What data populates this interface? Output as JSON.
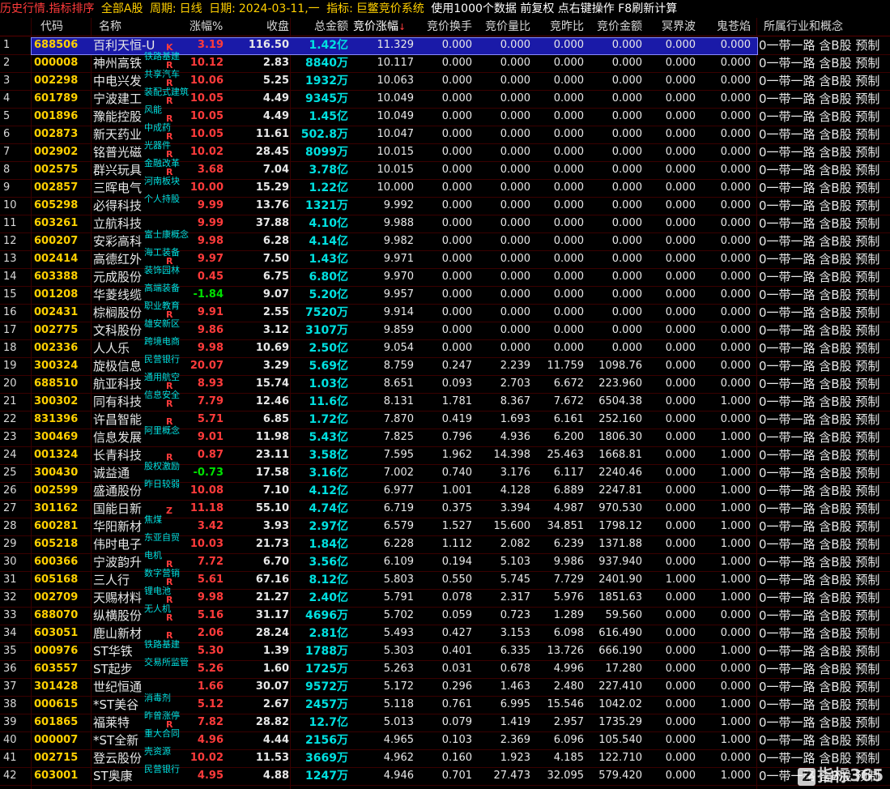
{
  "title_bar": {
    "view": "历史行情.指标排序",
    "scope": "全部A股",
    "period_label": "周期:",
    "period_value": "日线",
    "date_label": "日期:",
    "date_value": "2024-03-11,一",
    "indicator_label": "指标:",
    "indicator_value": "巨鳖竞价系统",
    "note": "使用1000个数据 前复权 点右键操作 F8刷新计算"
  },
  "headers": {
    "code": "代码",
    "name": "名称",
    "chg": "涨幅%",
    "close": "收盘",
    "amount": "总金额",
    "bid_chg": "竞价涨幅",
    "bid_turn": "竞价换手",
    "bid_vol": "竞价量比",
    "bid_yday": "竞昨比",
    "bid_amt": "竞价金额",
    "mj": "冥界波",
    "gc": "鬼苍焰",
    "industry": "所属行业和概念"
  },
  "sort_arrow": "↓",
  "rows": [
    {
      "idx": "1",
      "code": "688506",
      "name": "百利天恒-U",
      "tag": "",
      "flag": "K",
      "chg": "3.19",
      "close": "116.50",
      "amt": "1.42亿",
      "bp": "11.329",
      "bt": "0.000",
      "bv": "0.000",
      "by": "0.000",
      "ba": "0.000",
      "mj": "0.000",
      "gc": "0.000",
      "ind": "0一带一路 含B股 预制"
    },
    {
      "idx": "2",
      "code": "000008",
      "name": "神州高铁",
      "tag": "铁路基建",
      "flag": "R",
      "chg": "10.12",
      "close": "2.83",
      "amt": "8840万",
      "bp": "10.117",
      "bt": "0.000",
      "bv": "0.000",
      "by": "0.000",
      "ba": "0.000",
      "mj": "0.000",
      "gc": "0.000",
      "ind": "0一带一路 含B股 预制"
    },
    {
      "idx": "3",
      "code": "002298",
      "name": "中电兴发",
      "tag": "共享汽车",
      "flag": "R",
      "chg": "10.06",
      "close": "5.25",
      "amt": "1932万",
      "bp": "10.063",
      "bt": "0.000",
      "bv": "0.000",
      "by": "0.000",
      "ba": "0.000",
      "mj": "0.000",
      "gc": "0.000",
      "ind": "0一带一路 含B股 预制"
    },
    {
      "idx": "4",
      "code": "601789",
      "name": "宁波建工",
      "tag": "装配式建筑",
      "flag": "R",
      "chg": "10.05",
      "close": "4.49",
      "amt": "9345万",
      "bp": "10.049",
      "bt": "0.000",
      "bv": "0.000",
      "by": "0.000",
      "ba": "0.000",
      "mj": "0.000",
      "gc": "0.000",
      "ind": "0一带一路 含B股 预制"
    },
    {
      "idx": "5",
      "code": "001896",
      "name": "豫能控股",
      "tag": "风能",
      "flag": "R",
      "chg": "10.05",
      "close": "4.49",
      "amt": "1.45亿",
      "bp": "10.049",
      "bt": "0.000",
      "bv": "0.000",
      "by": "0.000",
      "ba": "0.000",
      "mj": "0.000",
      "gc": "0.000",
      "ind": "0一带一路 含B股 预制"
    },
    {
      "idx": "6",
      "code": "002873",
      "name": "新天药业",
      "tag": "中成药",
      "flag": "R",
      "chg": "10.05",
      "close": "11.61",
      "amt": "502.8万",
      "bp": "10.047",
      "bt": "0.000",
      "bv": "0.000",
      "by": "0.000",
      "ba": "0.000",
      "mj": "0.000",
      "gc": "0.000",
      "ind": "0一带一路 含B股 预制"
    },
    {
      "idx": "7",
      "code": "002902",
      "name": "铭普光磁",
      "tag": "光器件",
      "flag": "R",
      "chg": "10.02",
      "close": "28.45",
      "amt": "8099万",
      "bp": "10.015",
      "bt": "0.000",
      "bv": "0.000",
      "by": "0.000",
      "ba": "0.000",
      "mj": "0.000",
      "gc": "0.000",
      "ind": "0一带一路 含B股 预制"
    },
    {
      "idx": "8",
      "code": "002575",
      "name": "群兴玩具",
      "tag": "金融改革",
      "flag": "R",
      "chg": "3.68",
      "close": "7.04",
      "amt": "3.78亿",
      "bp": "10.015",
      "bt": "0.000",
      "bv": "0.000",
      "by": "0.000",
      "ba": "0.000",
      "mj": "0.000",
      "gc": "0.000",
      "ind": "0一带一路 含B股 预制"
    },
    {
      "idx": "9",
      "code": "002857",
      "name": "三晖电气",
      "tag": "河南板块",
      "flag": "",
      "chg": "10.00",
      "close": "15.29",
      "amt": "1.22亿",
      "bp": "10.000",
      "bt": "0.000",
      "bv": "0.000",
      "by": "0.000",
      "ba": "0.000",
      "mj": "0.000",
      "gc": "0.000",
      "ind": "0一带一路 含B股 预制"
    },
    {
      "idx": "10",
      "code": "605298",
      "name": "必得科技",
      "tag": "个人持股",
      "flag": "",
      "chg": "9.99",
      "close": "13.76",
      "amt": "1321万",
      "bp": "9.992",
      "bt": "0.000",
      "bv": "0.000",
      "by": "0.000",
      "ba": "0.000",
      "mj": "0.000",
      "gc": "0.000",
      "ind": "0一带一路 含B股 预制"
    },
    {
      "idx": "11",
      "code": "603261",
      "name": "立航科技",
      "tag": "",
      "flag": "",
      "chg": "9.99",
      "close": "37.88",
      "amt": "4.10亿",
      "bp": "9.988",
      "bt": "0.000",
      "bv": "0.000",
      "by": "0.000",
      "ba": "0.000",
      "mj": "0.000",
      "gc": "0.000",
      "ind": "0一带一路 含B股 预制"
    },
    {
      "idx": "12",
      "code": "600207",
      "name": "安彩高科",
      "tag": "富士康概念",
      "flag": "",
      "chg": "9.98",
      "close": "6.28",
      "amt": "4.14亿",
      "bp": "9.982",
      "bt": "0.000",
      "bv": "0.000",
      "by": "0.000",
      "ba": "0.000",
      "mj": "0.000",
      "gc": "0.000",
      "ind": "0一带一路 含B股 预制"
    },
    {
      "idx": "13",
      "code": "002414",
      "name": "高德红外",
      "tag": "海工装备",
      "flag": "R",
      "chg": "9.97",
      "close": "7.50",
      "amt": "1.43亿",
      "bp": "9.971",
      "bt": "0.000",
      "bv": "0.000",
      "by": "0.000",
      "ba": "0.000",
      "mj": "0.000",
      "gc": "0.000",
      "ind": "0一带一路 含B股 预制"
    },
    {
      "idx": "14",
      "code": "603388",
      "name": "元成股份",
      "tag": "装饰园林",
      "flag": "",
      "chg": "0.45",
      "close": "6.75",
      "amt": "6.80亿",
      "bp": "9.970",
      "bt": "0.000",
      "bv": "0.000",
      "by": "0.000",
      "ba": "0.000",
      "mj": "0.000",
      "gc": "0.000",
      "ind": "0一带一路 含B股 预制"
    },
    {
      "idx": "15",
      "code": "001208",
      "name": "华菱线缆",
      "tag": "高端装备",
      "flag": "",
      "chg": "-1.84",
      "close": "9.07",
      "amt": "5.20亿",
      "bp": "9.957",
      "bt": "0.000",
      "bv": "0.000",
      "by": "0.000",
      "ba": "0.000",
      "mj": "0.000",
      "gc": "0.000",
      "ind": "0一带一路 含B股 预制"
    },
    {
      "idx": "16",
      "code": "002431",
      "name": "棕榈股份",
      "tag": "职业教育",
      "flag": "R",
      "chg": "9.91",
      "close": "2.55",
      "amt": "7520万",
      "bp": "9.914",
      "bt": "0.000",
      "bv": "0.000",
      "by": "0.000",
      "ba": "0.000",
      "mj": "0.000",
      "gc": "0.000",
      "ind": "0一带一路 含B股 预制"
    },
    {
      "idx": "17",
      "code": "002775",
      "name": "文科股份",
      "tag": "雄安新区",
      "flag": "",
      "chg": "9.86",
      "close": "3.12",
      "amt": "3107万",
      "bp": "9.859",
      "bt": "0.000",
      "bv": "0.000",
      "by": "0.000",
      "ba": "0.000",
      "mj": "0.000",
      "gc": "0.000",
      "ind": "0一带一路 含B股 预制"
    },
    {
      "idx": "18",
      "code": "002336",
      "name": "人人乐",
      "tag": "跨境电商",
      "flag": "",
      "chg": "9.98",
      "close": "10.69",
      "amt": "2.50亿",
      "bp": "9.054",
      "bt": "0.000",
      "bv": "0.000",
      "by": "0.000",
      "ba": "0.000",
      "mj": "0.000",
      "gc": "0.000",
      "ind": "0一带一路 含B股 预制"
    },
    {
      "idx": "19",
      "code": "300324",
      "name": "旋极信息",
      "tag": "民营银行",
      "flag": "",
      "chg": "20.07",
      "close": "3.29",
      "amt": "5.69亿",
      "bp": "8.759",
      "bt": "0.247",
      "bv": "2.239",
      "by": "11.759",
      "ba": "1098.76",
      "mj": "0.000",
      "gc": "0.000",
      "ind": "0一带一路 含B股 预制"
    },
    {
      "idx": "20",
      "code": "688510",
      "name": "航亚科技",
      "tag": "通用航空",
      "flag": "R",
      "chg": "8.93",
      "close": "15.74",
      "amt": "1.03亿",
      "bp": "8.651",
      "bt": "0.093",
      "bv": "2.703",
      "by": "6.672",
      "ba": "223.960",
      "mj": "0.000",
      "gc": "0.000",
      "ind": "0一带一路 含B股 预制"
    },
    {
      "idx": "21",
      "code": "300302",
      "name": "同有科技",
      "tag": "信息安全",
      "flag": "R",
      "chg": "7.79",
      "close": "12.46",
      "amt": "11.6亿",
      "bp": "8.131",
      "bt": "1.781",
      "bv": "8.367",
      "by": "7.672",
      "ba": "6504.38",
      "mj": "0.000",
      "gc": "1.000",
      "ind": "0一带一路 含B股 预制"
    },
    {
      "idx": "22",
      "code": "831396",
      "name": "许昌智能",
      "tag": "",
      "flag": "R",
      "chg": "5.71",
      "close": "6.85",
      "amt": "1.72亿",
      "bp": "7.870",
      "bt": "0.419",
      "bv": "1.693",
      "by": "6.161",
      "ba": "252.160",
      "mj": "0.000",
      "gc": "0.000",
      "ind": "0一带一路 含B股 预制"
    },
    {
      "idx": "23",
      "code": "300469",
      "name": "信息发展",
      "tag": "阿里概念",
      "flag": "",
      "chg": "9.01",
      "close": "11.98",
      "amt": "5.43亿",
      "bp": "7.825",
      "bt": "0.796",
      "bv": "4.936",
      "by": "6.200",
      "ba": "1806.30",
      "mj": "0.000",
      "gc": "1.000",
      "ind": "0一带一路 含B股 预制"
    },
    {
      "idx": "24",
      "code": "001324",
      "name": "长青科技",
      "tag": "",
      "flag": "R",
      "chg": "0.87",
      "close": "23.11",
      "amt": "3.58亿",
      "bp": "7.595",
      "bt": "1.962",
      "bv": "14.398",
      "by": "25.463",
      "ba": "1668.81",
      "mj": "0.000",
      "gc": "1.000",
      "ind": "0一带一路 含B股 预制"
    },
    {
      "idx": "25",
      "code": "300430",
      "name": "诚益通",
      "tag": "股权激励",
      "flag": "",
      "chg": "-0.73",
      "close": "17.58",
      "amt": "3.16亿",
      "bp": "7.002",
      "bt": "0.740",
      "bv": "3.176",
      "by": "6.117",
      "ba": "2240.46",
      "mj": "0.000",
      "gc": "1.000",
      "ind": "0一带一路 含B股 预制"
    },
    {
      "idx": "26",
      "code": "002599",
      "name": "盛通股份",
      "tag": "昨日较弱",
      "flag": "",
      "chg": "10.08",
      "close": "7.10",
      "amt": "4.12亿",
      "bp": "6.977",
      "bt": "1.001",
      "bv": "4.128",
      "by": "6.889",
      "ba": "2247.81",
      "mj": "0.000",
      "gc": "1.000",
      "ind": "0一带一路 含B股 预制"
    },
    {
      "idx": "27",
      "code": "301162",
      "name": "国能日新",
      "tag": "",
      "flag": "Z",
      "chg": "11.18",
      "close": "55.10",
      "amt": "4.74亿",
      "bp": "6.719",
      "bt": "0.375",
      "bv": "3.394",
      "by": "4.987",
      "ba": "970.530",
      "mj": "0.000",
      "gc": "1.000",
      "ind": "0一带一路 含B股 预制"
    },
    {
      "idx": "28",
      "code": "600281",
      "name": "华阳新材",
      "tag": "焦煤",
      "flag": "",
      "chg": "3.42",
      "close": "3.93",
      "amt": "2.97亿",
      "bp": "6.579",
      "bt": "1.527",
      "bv": "15.600",
      "by": "34.851",
      "ba": "1798.12",
      "mj": "0.000",
      "gc": "1.000",
      "ind": "0一带一路 含B股 预制"
    },
    {
      "idx": "29",
      "code": "605218",
      "name": "伟时电子",
      "tag": "东亚自贸",
      "flag": "",
      "chg": "10.03",
      "close": "21.73",
      "amt": "1.84亿",
      "bp": "6.228",
      "bt": "1.112",
      "bv": "2.082",
      "by": "6.239",
      "ba": "1371.88",
      "mj": "0.000",
      "gc": "1.000",
      "ind": "0一带一路 含B股 预制"
    },
    {
      "idx": "30",
      "code": "600366",
      "name": "宁波韵升",
      "tag": "电机",
      "flag": "R",
      "chg": "7.72",
      "close": "6.70",
      "amt": "3.56亿",
      "bp": "6.109",
      "bt": "0.194",
      "bv": "5.103",
      "by": "9.986",
      "ba": "937.940",
      "mj": "0.000",
      "gc": "1.000",
      "ind": "0一带一路 含B股 预制"
    },
    {
      "idx": "31",
      "code": "605168",
      "name": "三人行",
      "tag": "数字营销",
      "flag": "R",
      "chg": "5.61",
      "close": "67.16",
      "amt": "8.12亿",
      "bp": "5.803",
      "bt": "0.550",
      "bv": "5.745",
      "by": "7.729",
      "ba": "2401.90",
      "mj": "1.000",
      "gc": "1.000",
      "ind": "0一带一路 含B股 预制"
    },
    {
      "idx": "32",
      "code": "002709",
      "name": "天赐材料",
      "tag": "锂电池",
      "flag": "R",
      "chg": "9.98",
      "close": "21.27",
      "amt": "2.40亿",
      "bp": "5.791",
      "bt": "0.078",
      "bv": "2.317",
      "by": "5.976",
      "ba": "1851.63",
      "mj": "0.000",
      "gc": "1.000",
      "ind": "0一带一路 含B股 预制"
    },
    {
      "idx": "33",
      "code": "688070",
      "name": "纵横股份",
      "tag": "无人机",
      "flag": "R",
      "chg": "5.16",
      "close": "31.17",
      "amt": "4696万",
      "bp": "5.702",
      "bt": "0.059",
      "bv": "0.723",
      "by": "1.289",
      "ba": "59.560",
      "mj": "0.000",
      "gc": "0.000",
      "ind": "0一带一路 含B股 预制"
    },
    {
      "idx": "34",
      "code": "603051",
      "name": "鹿山新材",
      "tag": "",
      "flag": "R",
      "chg": "2.06",
      "close": "28.24",
      "amt": "2.81亿",
      "bp": "5.493",
      "bt": "0.427",
      "bv": "3.153",
      "by": "6.098",
      "ba": "616.490",
      "mj": "0.000",
      "gc": "0.000",
      "ind": "0一带一路 含B股 预制"
    },
    {
      "idx": "35",
      "code": "000976",
      "name": "ST华铁",
      "tag": "铁路基建",
      "flag": "",
      "chg": "5.30",
      "close": "1.39",
      "amt": "1788万",
      "bp": "5.303",
      "bt": "0.401",
      "bv": "6.335",
      "by": "13.726",
      "ba": "666.190",
      "mj": "0.000",
      "gc": "1.000",
      "ind": "0一带一路 含B股 预制"
    },
    {
      "idx": "36",
      "code": "603557",
      "name": "ST起步",
      "tag": "交易所监管",
      "flag": "",
      "chg": "5.26",
      "close": "1.60",
      "amt": "1725万",
      "bp": "5.263",
      "bt": "0.031",
      "bv": "0.678",
      "by": "4.996",
      "ba": "17.280",
      "mj": "0.000",
      "gc": "0.000",
      "ind": "0一带一路 含B股 预制"
    },
    {
      "idx": "37",
      "code": "301428",
      "name": "世纪恒通",
      "tag": "",
      "flag": "",
      "chg": "1.66",
      "close": "30.07",
      "amt": "9572万",
      "bp": "5.172",
      "bt": "0.296",
      "bv": "1.463",
      "by": "2.480",
      "ba": "227.410",
      "mj": "0.000",
      "gc": "0.000",
      "ind": "0一带一路 含B股 预制"
    },
    {
      "idx": "38",
      "code": "000615",
      "name": "*ST美谷",
      "tag": "消毒剂",
      "flag": "",
      "chg": "5.12",
      "close": "2.67",
      "amt": "2457万",
      "bp": "5.118",
      "bt": "0.761",
      "bv": "6.995",
      "by": "15.546",
      "ba": "1042.02",
      "mj": "0.000",
      "gc": "1.000",
      "ind": "0一带一路 含B股 预制"
    },
    {
      "idx": "39",
      "code": "601865",
      "name": "福莱特",
      "tag": "昨曾涨停",
      "flag": "R",
      "chg": "7.82",
      "close": "28.82",
      "amt": "12.7亿",
      "bp": "5.013",
      "bt": "0.079",
      "bv": "1.419",
      "by": "2.957",
      "ba": "1735.29",
      "mj": "0.000",
      "gc": "1.000",
      "ind": "0一带一路 含B股 预制"
    },
    {
      "idx": "40",
      "code": "000007",
      "name": "*ST全新",
      "tag": "重大合同",
      "flag": "",
      "chg": "4.96",
      "close": "4.44",
      "amt": "2156万",
      "bp": "4.965",
      "bt": "0.103",
      "bv": "2.369",
      "by": "6.096",
      "ba": "105.540",
      "mj": "0.000",
      "gc": "1.000",
      "ind": "0一带一路 含B股 预制"
    },
    {
      "idx": "41",
      "code": "002715",
      "name": "登云股份",
      "tag": "壳资源",
      "flag": "",
      "chg": "10.02",
      "close": "11.53",
      "amt": "3669万",
      "bp": "4.962",
      "bt": "0.160",
      "bv": "1.923",
      "by": "4.185",
      "ba": "122.710",
      "mj": "0.000",
      "gc": "0.000",
      "ind": "0一带一路 含B股 预制"
    },
    {
      "idx": "42",
      "code": "603001",
      "name": "ST奥康",
      "tag": "民营银行",
      "flag": "",
      "chg": "4.95",
      "close": "4.88",
      "amt": "1247万",
      "bp": "4.946",
      "bt": "0.701",
      "bv": "27.473",
      "by": "32.095",
      "ba": "579.420",
      "mj": "0.000",
      "gc": "1.000",
      "ind": "0一带一路 含B股 预制"
    }
  ],
  "watermark": {
    "logo_char": "Z",
    "text": "指标365"
  }
}
